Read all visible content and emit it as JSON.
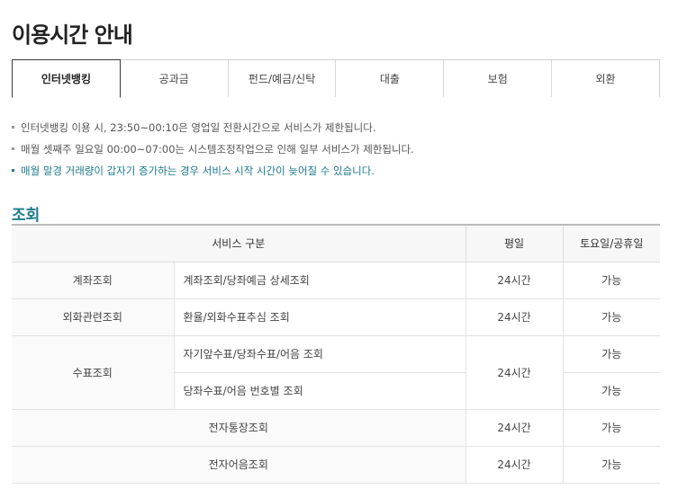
{
  "page": {
    "title": "이용시간 안내"
  },
  "tabs": [
    {
      "label": "인터넷뱅킹",
      "active": true
    },
    {
      "label": "공과금",
      "active": false
    },
    {
      "label": "펀드/예금/신탁",
      "active": false
    },
    {
      "label": "대출",
      "active": false
    },
    {
      "label": "보험",
      "active": false
    },
    {
      "label": "외환",
      "active": false
    }
  ],
  "notes": [
    "인터넷뱅킹 이용 시, 23:50~00:10은 영업일 전환시간으로 서비스가 제한됩니다.",
    "매월 셋째주 일요일 00:00~07:00는 시스템조정작업으로 인해 일부 서비스가 제한됩니다.",
    "매월 말경 거래량이 갑자기 증가하는 경우 서비스 시작 시간이 늦어질 수 있습니다."
  ],
  "section": {
    "title": "조회"
  },
  "table": {
    "headers": {
      "service": "서비스 구분",
      "weekday": "평일",
      "weekend": "토요일/공휴일"
    },
    "rows": [
      {
        "category": "계좌조회",
        "detail": "계좌조회/당좌예금 상세조회",
        "weekday": "24시간",
        "weekend": "가능"
      },
      {
        "category": "외화관련조회",
        "detail": "환율/외화수표추심 조회",
        "weekday": "24시간",
        "weekend": "가능"
      },
      {
        "category": "수표조회",
        "detail": "자기앞수표/당좌수표/어음 조회",
        "weekday": "24시간",
        "weekend": "가능"
      },
      {
        "detail": "당좌수표/어음 번호별 조회",
        "weekend": "가능"
      },
      {
        "category": "전자통장조회",
        "weekday": "24시간",
        "weekend": "가능"
      },
      {
        "category": "전자어음조회",
        "weekday": "24시간",
        "weekend": "가능"
      }
    ]
  }
}
